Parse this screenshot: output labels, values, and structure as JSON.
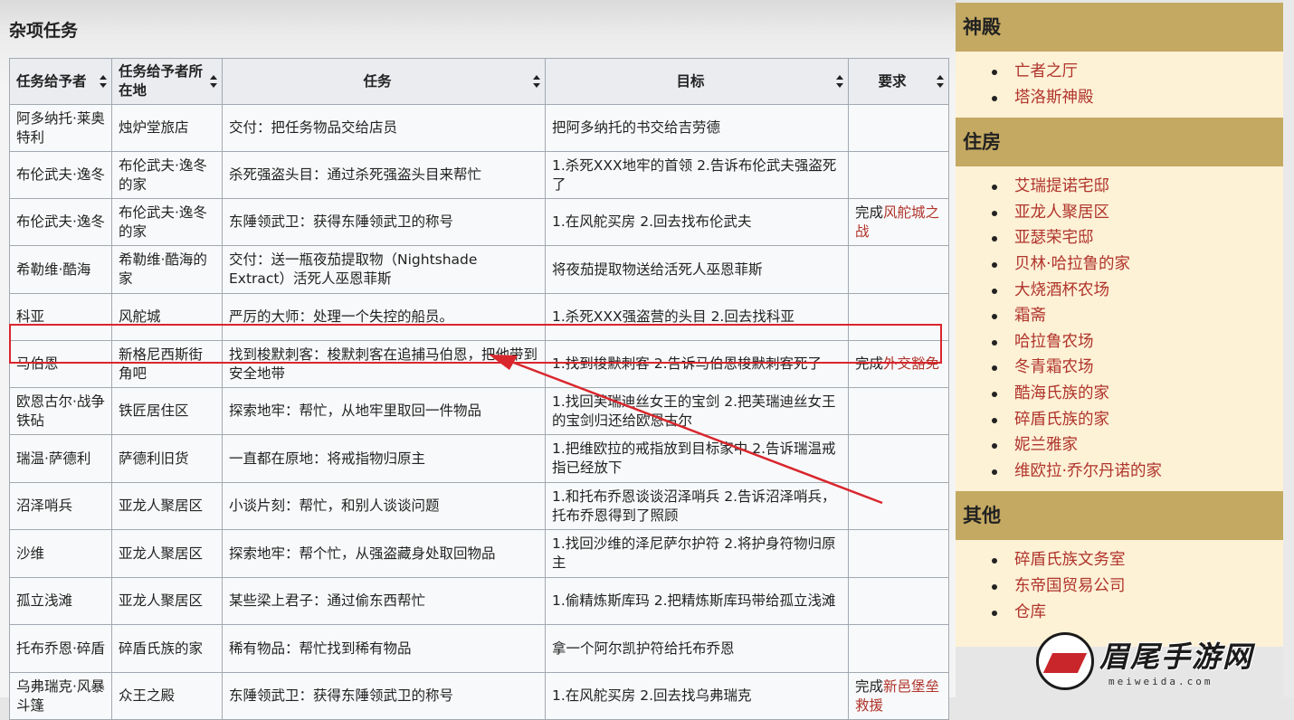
{
  "section_title": "杂项任务",
  "table": {
    "headers": [
      "任务给予者",
      "任务给予者所在地",
      "任务",
      "目标",
      "要求"
    ],
    "rows": [
      {
        "giver": "阿多纳托·莱奥特利",
        "location": "烛炉堂旅店",
        "quest": "交付：把任务物品交给店员",
        "goal": "把阿多纳托的书交给吉劳德",
        "req_prefix": "",
        "req_link": ""
      },
      {
        "giver": "布伦武夫·逸冬",
        "location": "布伦武夫·逸冬的家",
        "quest": "杀死强盗头目：通过杀死强盗头目来帮忙",
        "goal": "1.杀死XXX地牢的首领 2.告诉布伦武夫强盗死了",
        "req_prefix": "",
        "req_link": ""
      },
      {
        "giver": "布伦武夫·逸冬",
        "location": "布伦武夫·逸冬的家",
        "quest": "东陲领武卫：获得东陲领武卫的称号",
        "goal": "1.在风舵买房 2.回去找布伦武夫",
        "req_prefix": "完成",
        "req_link": "风舵城之战"
      },
      {
        "giver": "希勒维·酷海",
        "location": "希勒维·酷海的家",
        "quest": "交付：送一瓶夜茄提取物（Nightshade Extract）活死人巫恩菲斯",
        "goal": "将夜茄提取物送给活死人巫恩菲斯",
        "req_prefix": "",
        "req_link": ""
      },
      {
        "giver": "科亚",
        "location": "风舵城",
        "quest": "严厉的大师：处理一个失控的船员。",
        "goal": "1.杀死XXX强盗营的头目 2.回去找科亚",
        "req_prefix": "",
        "req_link": ""
      },
      {
        "giver": "马伯恩",
        "location": "新格尼西斯街角吧",
        "quest": "找到梭默刺客：梭默刺客在追捕马伯恩，把他带到安全地带",
        "goal": "1.找到梭默刺客 2.告诉马伯恩梭默刺客死了",
        "req_prefix": "完成",
        "req_link": "外交豁免"
      },
      {
        "giver": "欧恩古尔·战争铁砧",
        "location": "铁匠居住区",
        "quest": "探索地牢：帮忙，从地牢里取回一件物品",
        "goal": "1.找回芙瑞迪丝女王的宝剑 2.把芙瑞迪丝女王的宝剑归还给欧恩古尔",
        "req_prefix": "",
        "req_link": ""
      },
      {
        "giver": "瑞温·萨德利",
        "location": "萨德利旧货",
        "quest": "一直都在原地：将戒指物归原主",
        "goal": "1.把维欧拉的戒指放到目标家中 2.告诉瑞温戒指已经放下",
        "req_prefix": "",
        "req_link": ""
      },
      {
        "giver": "沼泽哨兵",
        "location": "亚龙人聚居区",
        "quest": "小谈片刻：帮忙，和别人谈谈问题",
        "goal": "1.和托布乔恩谈谈沼泽哨兵 2.告诉沼泽哨兵，托布乔恩得到了照顾",
        "req_prefix": "",
        "req_link": ""
      },
      {
        "giver": "沙维",
        "location": "亚龙人聚居区",
        "quest": "探索地牢：帮个忙，从强盗藏身处取回物品",
        "goal": "1.找回沙维的泽尼萨尔护符 2.将护身符物归原主",
        "req_prefix": "",
        "req_link": ""
      },
      {
        "giver": "孤立浅滩",
        "location": "亚龙人聚居区",
        "quest": "某些梁上君子：通过偷东西帮忙",
        "goal": "1.偷精炼斯库玛 2.把精炼斯库玛带给孤立浅滩",
        "req_prefix": "",
        "req_link": ""
      },
      {
        "giver": "托布乔恩·碎盾",
        "location": "碎盾氏族的家",
        "quest": "稀有物品：帮忙找到稀有物品",
        "goal": "拿一个阿尔凯护符给托布乔恩",
        "req_prefix": "",
        "req_link": ""
      },
      {
        "giver": "乌弗瑞克·风暴斗篷",
        "location": "众王之殿",
        "quest": "东陲领武卫：获得东陲领武卫的称号",
        "goal": "1.在风舵买房 2.回去找乌弗瑞克",
        "req_prefix": "完成",
        "req_link": "新邑堡垒救援"
      }
    ]
  },
  "sidebar": {
    "sections": [
      {
        "title": "神殿",
        "items": [
          "亡者之厅",
          "塔洛斯神殿"
        ]
      },
      {
        "title": "住房",
        "items": [
          "艾瑞提诺宅邸",
          "亚龙人聚居区",
          "亚瑟荣宅邸",
          "贝林·哈拉鲁的家",
          "大烧酒杯农场",
          "霜斋",
          "哈拉鲁农场",
          "冬青霜农场",
          "酷海氏族的家",
          "碎盾氏族的家",
          "妮兰雅家",
          "维欧拉·乔尔丹诺的家"
        ]
      },
      {
        "title": "其他",
        "items": [
          "碎盾氏族文务室",
          "东帝国贸易公司",
          "仓库"
        ]
      }
    ]
  },
  "watermark": {
    "text": "眉尾手游网",
    "url": "meiweida.com"
  },
  "colors": {
    "link": "#b0342b",
    "sidebar_header": "#c4a962",
    "sidebar_bg": "#fdf1d6",
    "annotation": "#d9262d",
    "table_border": "#a2a9b1",
    "header_bg": "#eaecf0"
  }
}
